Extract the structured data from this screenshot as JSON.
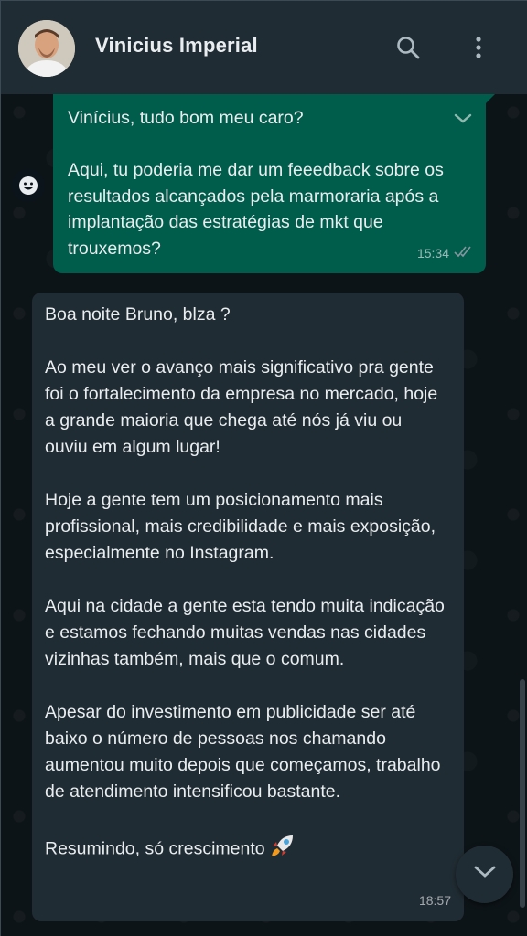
{
  "header": {
    "contact_name": "Vinicius Imperial",
    "icons": [
      "search-icon",
      "menu-dots-icon"
    ]
  },
  "messages": [
    {
      "direction": "outgoing",
      "text": "Vinícius, tudo bom meu caro?\n\nAqui, tu poderia me dar um feeedback sobre os resultados alcançados pela marmoraria após a implantação das estratégias de mkt que trouxemos?",
      "time": "15:34",
      "status": "read"
    },
    {
      "direction": "incoming",
      "text": "Boa noite Bruno, blza ?\n\nAo meu ver o avanço mais significativo pra gente foi o fortalecimento da empresa no mercado, hoje a grande maioria que chega até nós já viu ou ouviu em algum lugar!\n\nHoje a gente tem um posicionamento mais profissional, mais credibilidade e mais exposição, especialmente no Instagram.\n\nAqui na cidade a gente esta tendo muita indicação e estamos fechando muitas vendas nas cidades vizinhas também, mais que o comum.\n\nApesar do investimento em publicidade ser até baixo o número de pessoas nos chamando aumentou muito depois que começamos, trabalho de atendimento intensificou bastante.\n\nResumindo, só crescimento",
      "emoji": "rocket-icon",
      "time": "18:57"
    }
  ],
  "colors": {
    "header_bg": "#202c33",
    "outgoing_bubble": "#005c4b",
    "incoming_bubble": "#202c33",
    "text": "#e9edef",
    "read_ticks": "#8696a0"
  }
}
